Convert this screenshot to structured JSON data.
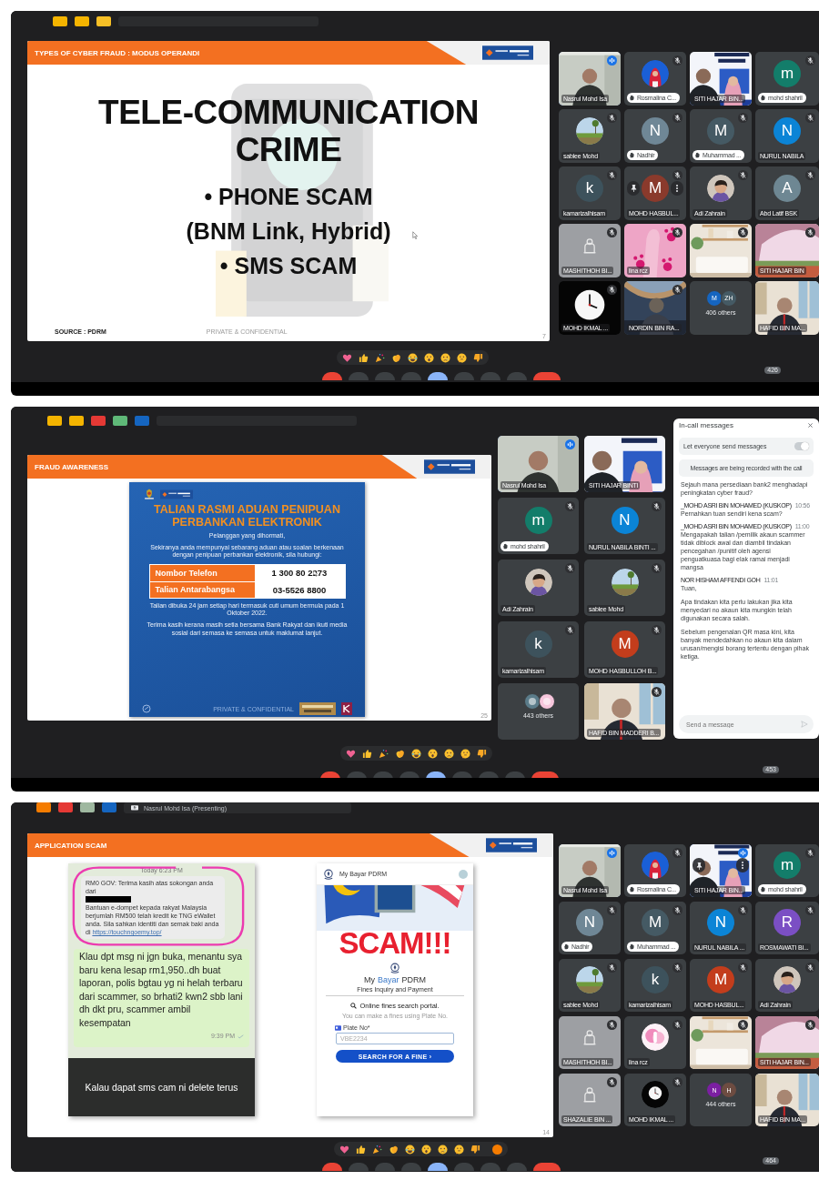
{
  "screens": [
    {
      "slide": {
        "kind": "title-bullets",
        "header": "TYPES OF CYBER FRAUD : MODUS OPERANDI",
        "title": [
          "TELE-COMMUNICATION",
          "CRIME"
        ],
        "lines": [
          "• PHONE SCAM",
          "(BNM Link, Hybrid)",
          "• SMS SCAM"
        ],
        "source": "SOURCE : PDRM",
        "footer": "PRIVATE & CONFIDENTIAL",
        "page": "7"
      },
      "tiles": [
        {
          "kind": "video",
          "name": "Nasrul Mohd Isa",
          "muted": false,
          "hand_raised": false,
          "speaking": true,
          "hovered": false
        },
        {
          "name": "Rosmalina C...",
          "muted": true,
          "hand_raised": true,
          "speaking": false,
          "hovered": false
        },
        {
          "kind": "video",
          "name": "SITI HAJAR BIN...",
          "muted": false,
          "hand_raised": false,
          "speaking": false,
          "hovered": false
        },
        {
          "kind": "avatar",
          "letter": "m",
          "color": "#137d6a",
          "name": "mohd shahril",
          "muted": true,
          "hand_raised": true,
          "speaking": false,
          "hovered": false
        },
        {
          "name": "sablee Mohd",
          "muted": true,
          "hand_raised": false,
          "speaking": false,
          "hovered": false
        },
        {
          "kind": "avatar",
          "letter": "N",
          "color": "#6f8796",
          "name": "Nadhir",
          "muted": true,
          "hand_raised": true,
          "speaking": false,
          "hovered": false
        },
        {
          "kind": "avatar",
          "letter": "M",
          "color": "#455a64",
          "name": "Muhammad ...",
          "muted": true,
          "hand_raised": true,
          "speaking": false,
          "hovered": false
        },
        {
          "kind": "avatar",
          "letter": "N",
          "color": "#0b84d6",
          "name": "NURUL NABILA",
          "muted": true,
          "hand_raised": false,
          "speaking": false,
          "hovered": false
        },
        {
          "kind": "avatar",
          "letter": "k",
          "color": "#3d525c",
          "name": "kamarizalhisam",
          "muted": true,
          "hand_raised": false,
          "speaking": false,
          "hovered": false
        },
        {
          "kind": "avatar",
          "letter": "M",
          "color": "#8a3a2c",
          "name": "MOHD HASBUL...",
          "muted": true,
          "hand_raised": false,
          "speaking": false,
          "hovered": true
        },
        {
          "name": "Adi Zahrain",
          "muted": true,
          "hand_raised": false,
          "speaking": false,
          "hovered": false
        },
        {
          "kind": "avatar",
          "letter": "A",
          "color": "#6e8793",
          "name": "Abd Latif BSK",
          "muted": true,
          "hand_raised": false,
          "speaking": false,
          "hovered": false
        },
        {
          "kind": "blank",
          "name": "MASHITHOH BI...",
          "muted": true,
          "hand_raised": false,
          "speaking": false,
          "hovered": false
        },
        {
          "kind": "video",
          "name": "lina rcz",
          "muted": true,
          "hand_raised": false,
          "speaking": false,
          "hovered": false
        },
        {
          "kind": "video",
          "muted": true,
          "hand_raised": false,
          "speaking": false,
          "hovered": false
        },
        {
          "kind": "video",
          "name": "SITI HAJAR BIN",
          "muted": true,
          "hand_raised": false,
          "speaking": false,
          "hovered": false
        },
        {
          "kind": "video",
          "name": "MOHD IKMAL ...",
          "muted": true,
          "hand_raised": false,
          "speaking": false,
          "hovered": false
        },
        {
          "kind": "video",
          "name": "NORDIN BIN RA...",
          "muted": true,
          "hand_raised": false,
          "speaking": false,
          "hovered": false
        },
        {
          "kind": "others",
          "label": "406 others",
          "avatars": [
            {
              "letter": "M",
              "color": "#1565c0"
            },
            {
              "letter": "ZH",
              "color": "#455a64"
            }
          ]
        },
        {
          "kind": "video",
          "name": "HAFID BIN MA...",
          "muted": false,
          "hand_raised": false,
          "speaking": false,
          "hovered": false
        }
      ],
      "participant_count": "426",
      "tone_button": false
    },
    {
      "slide": {
        "kind": "poster",
        "header": "FRAUD AWARENESS",
        "title": "TALIAN RASMI ADUAN PENIPUAN PERBANKAN ELEKTRONIK",
        "greeting": "Pelanggan yang dihormati,",
        "intro": "Sekiranya anda mempunyai sebarang aduan atau soalan berkenaan dengan penipuan perbankan elektronik, sila hubungi:",
        "rows": [
          {
            "label": "Nombor Telefon",
            "value": "1 300 80 2273"
          },
          {
            "label": "Talian Antarabangsa",
            "value": "03-5526 8800"
          }
        ],
        "notes": [
          "Talian dibuka 24 jam setiap hari termasuk cuti umum bermula pada 1 Oktober 2022.",
          "Terima kasih kerana masih setia bersama Bank Rakyat dan ikuti media sosial dari semasa ke semasa untuk maklumat lanjut."
        ],
        "footer": "PRIVATE & CONFIDENTIAL",
        "page": "25"
      },
      "tiles": [
        {
          "kind": "video",
          "name": "Nasrul Mohd Isa",
          "muted": false,
          "hand_raised": false,
          "speaking": true,
          "hovered": false
        },
        {
          "kind": "video",
          "name": "SITI HAJAR BINTI",
          "muted": false,
          "hand_raised": false,
          "speaking": false,
          "hovered": false
        },
        {
          "kind": "avatar",
          "letter": "m",
          "color": "#137d6a",
          "name": "mohd shahril",
          "muted": true,
          "hand_raised": true,
          "speaking": false,
          "hovered": false
        },
        {
          "kind": "avatar",
          "letter": "N",
          "color": "#0b84d6",
          "name": "NURUL NABILA BINTI ...",
          "muted": true,
          "hand_raised": false,
          "speaking": false,
          "hovered": false
        },
        {
          "name": "Adi Zahrain",
          "muted": true,
          "hand_raised": false,
          "speaking": false,
          "hovered": false
        },
        {
          "name": "sablee Mohd",
          "muted": true,
          "hand_raised": false,
          "speaking": false,
          "hovered": false
        },
        {
          "kind": "avatar",
          "letter": "k",
          "color": "#3d525c",
          "name": "kamarizalhisam",
          "muted": true,
          "hand_raised": false,
          "speaking": false,
          "hovered": false
        },
        {
          "kind": "avatar",
          "letter": "M",
          "color": "#c33d1c",
          "name": "MOHD HASBULLOH B...",
          "muted": true,
          "hand_raised": false,
          "speaking": false,
          "hovered": false
        },
        {
          "kind": "others",
          "label": "443 others",
          "avatars": [
            {
              "color": "#5b7c8a"
            },
            {
              "color": "#f6c6dc"
            }
          ]
        },
        {
          "kind": "video",
          "name": "HAFID BIN MADDERI B...",
          "muted": true,
          "hand_raised": false,
          "speaking": false,
          "hovered": false
        }
      ],
      "chat": {
        "title": "In-call messages",
        "toggle_label": "Let everyone send messages",
        "toggle_on": true,
        "notice": "Messages are being recorded with the call",
        "messages": [
          {
            "paragraphs": [
              "Sejauh mana persediaan bank2 menghadapi peningkatan cyber fraud?"
            ]
          },
          {
            "sender": "_MOHD ASRI BIN MOHAMED (KUSKOP)",
            "time": "10:56",
            "paragraphs": [
              "Pernahkan tuan sendiri kena scam?"
            ]
          },
          {
            "sender": "_MOHD ASRI BIN MOHAMED (KUSKOP)",
            "time": "11:00",
            "paragraphs": [
              "Mengapakah talian /pemilik akaun scammer tidak diblock awal dan diambil tindakan pencegahan /punitif oleh agensi penguatkuasa bagi elak ramai menjadi mangsa"
            ]
          },
          {
            "sender": "NOR HISHAM AFFENDI GOH",
            "time": "11:01",
            "paragraphs": [
              "Tuan,",
              "Apa tindakan kita perlu lakukan jika kita menyedari no akaun kita mungkin telah digunakan secara salah.",
              "Sebelum pengenalan QR masa kini, kita banyak mendedahkan no akaun kita dalam urusan/mengisi borang tertentu dengan pihak ketiga."
            ]
          }
        ],
        "placeholder": "Send a message"
      },
      "participant_count": "453",
      "tone_button": false
    },
    {
      "presenting": "Nasrul Mohd Isa (Presenting)",
      "slide": {
        "kind": "screenshots",
        "header": "APPLICATION SCAM",
        "chat": {
          "date": "Today 6:23 PM",
          "sms_start": "RM0 GOV: Terima kasih atas sokongan anda dari",
          "sms_rest": "Bantuan e-dompet kepada rakyat Malaysia berjumlah RM500 telah kredit ke TNG eWallet anda. Sila sahkan identiti dan semak baki anda di",
          "link": "https://touchngoemy.top/",
          "message": "Klau dpt msg ni jgn buka, menantu sya baru kena lesap rm1,950..dh buat laporan, polis bgtau yg ni helah terbaru dari scammer, so brhati2 kwn2 sbb lani dh dkt pru, scammer ambil kesempatan",
          "time": "9:39 PM",
          "caption": "Kalau dapat sms cam ni delete terus"
        },
        "app": {
          "title": "My Bayar PDRM",
          "stamp": "SCAM!!!",
          "brand": [
            {
              "text": "My",
              "accent": false
            },
            {
              "text": "Bayar",
              "accent": true
            },
            {
              "text": "PDRM",
              "accent": false
            }
          ],
          "subtitle": "Fines Inquiry and Payment",
          "search_title": "Online fines search portal.",
          "hint": "You can make a fines using Plate No.",
          "field_label": "Plate No*",
          "placeholder": "VBE2234",
          "button": "SEARCH FOR A FINE ›"
        },
        "page": "14"
      },
      "tiles": [
        {
          "kind": "video",
          "name": "Nasrul Mohd Isa",
          "muted": false,
          "hand_raised": false,
          "speaking": true,
          "hovered": false
        },
        {
          "name": "Rosmalina C...",
          "muted": true,
          "hand_raised": true,
          "speaking": false,
          "hovered": false
        },
        {
          "kind": "video",
          "name": "SITI HAJAR BIN...",
          "muted": false,
          "hand_raised": false,
          "speaking": true,
          "hovered": true
        },
        {
          "kind": "avatar",
          "letter": "m",
          "color": "#137d6a",
          "name": "mohd shahril",
          "muted": true,
          "hand_raised": true,
          "speaking": false,
          "hovered": false
        },
        {
          "kind": "avatar",
          "letter": "N",
          "color": "#6f8796",
          "name": "Nadhir",
          "muted": true,
          "hand_raised": true,
          "speaking": false,
          "hovered": false
        },
        {
          "kind": "avatar",
          "letter": "M",
          "color": "#455a64",
          "name": "Muhammad ...",
          "muted": true,
          "hand_raised": true,
          "speaking": false,
          "hovered": false
        },
        {
          "kind": "avatar",
          "letter": "N",
          "color": "#0b84d6",
          "name": "NURUL NABILA ...",
          "muted": true,
          "hand_raised": false,
          "speaking": false,
          "hovered": false
        },
        {
          "kind": "avatar",
          "letter": "R",
          "color": "#7b4fc4",
          "name": "ROSMAWATI BI...",
          "muted": true,
          "hand_raised": false,
          "speaking": false,
          "hovered": false
        },
        {
          "name": "sablee Mohd",
          "muted": true,
          "hand_raised": false,
          "speaking": false,
          "hovered": false
        },
        {
          "kind": "avatar",
          "letter": "k",
          "color": "#3d525c",
          "name": "kamarizalhisam",
          "muted": true,
          "hand_raised": false,
          "speaking": false,
          "hovered": false
        },
        {
          "kind": "avatar",
          "letter": "M",
          "color": "#c33d1c",
          "name": "MOHD HASBUL...",
          "muted": true,
          "hand_raised": false,
          "speaking": false,
          "hovered": false
        },
        {
          "name": "Adi Zahrain",
          "muted": true,
          "hand_raised": false,
          "speaking": false,
          "hovered": false
        },
        {
          "kind": "blank",
          "name": "MASHITHOH BI...",
          "muted": true,
          "hand_raised": false,
          "speaking": false,
          "hovered": false
        },
        {
          "name": "lina rcz",
          "muted": true,
          "hand_raised": false,
          "speaking": false,
          "hovered": false
        },
        {
          "kind": "video",
          "muted": true,
          "hand_raised": false,
          "speaking": false,
          "hovered": false
        },
        {
          "kind": "video",
          "name": "SITI HAJAR BIN...",
          "muted": true,
          "hand_raised": false,
          "speaking": false,
          "hovered": false
        },
        {
          "kind": "blank",
          "name": "SHAZALIE BIN ...",
          "muted": true,
          "hand_raised": false,
          "speaking": false,
          "hovered": false
        },
        {
          "name": "MOHD IKMAL ...",
          "muted": true,
          "hand_raised": false,
          "speaking": false,
          "hovered": false
        },
        {
          "kind": "others",
          "label": "444 others",
          "avatars": [
            {
              "letter": "N",
              "color": "#7b1fa2"
            },
            {
              "letter": "H",
              "color": "#6d4c41"
            }
          ]
        },
        {
          "kind": "video",
          "name": "HAFID BIN MA...",
          "muted": false,
          "hand_raised": false,
          "speaking": false,
          "hovered": false
        }
      ],
      "participant_count": "464",
      "tone_button": true
    }
  ]
}
